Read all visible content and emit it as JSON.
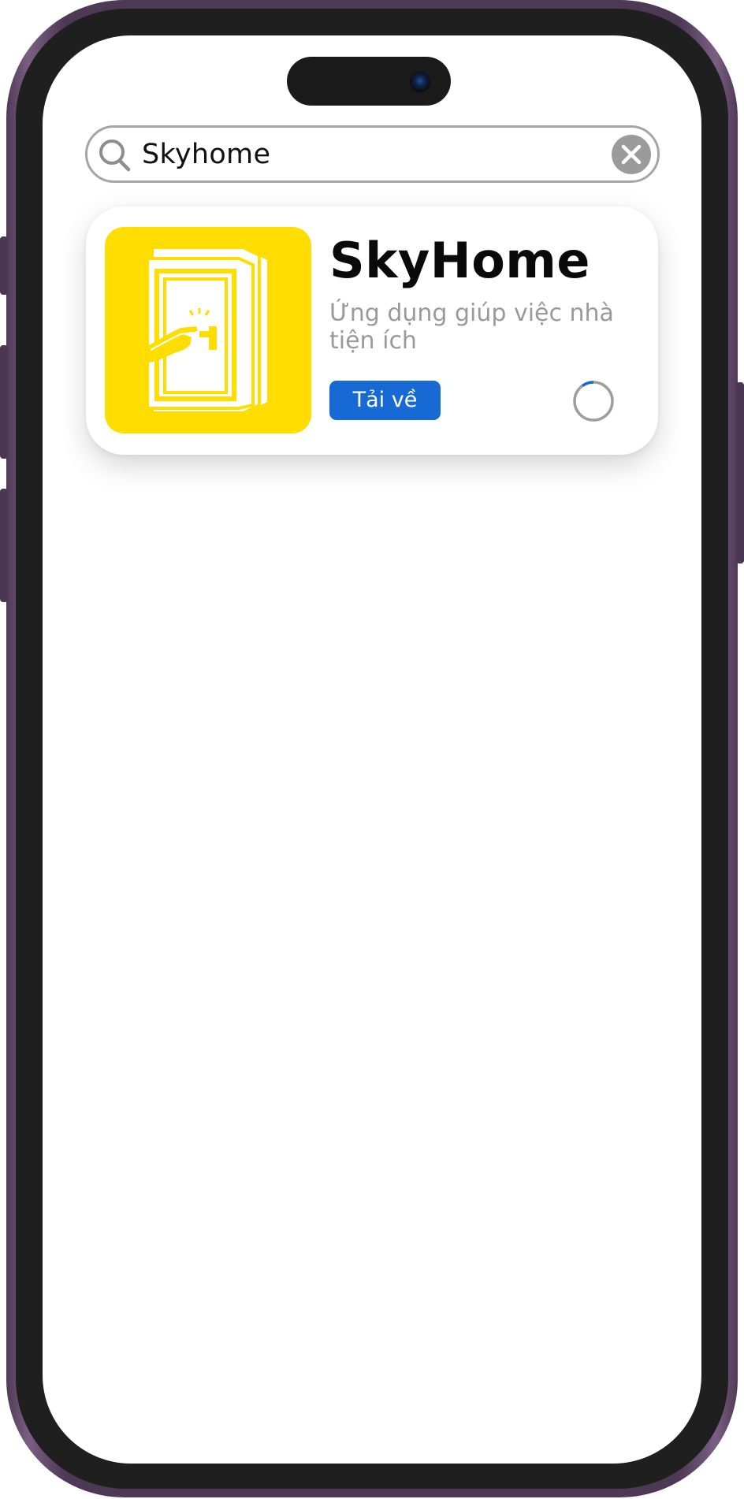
{
  "search": {
    "query": "Skyhome"
  },
  "result": {
    "app_name": "SkyHome",
    "description": "Ứng dụng giúp việc nhà tiện ích",
    "download_label": "Tải về",
    "download_progress": 0.1
  },
  "icons": {
    "search": "search-icon",
    "clear": "close-icon",
    "app": "door-tap-icon",
    "progress": "spinner-icon"
  },
  "colors": {
    "frame": "#4e3955",
    "bezel": "#1f1f1f",
    "app_icon_bg": "#ffdd00",
    "accent": "#176ad3",
    "muted_text": "#9a9a9a",
    "search_border": "#a5a5a5"
  }
}
